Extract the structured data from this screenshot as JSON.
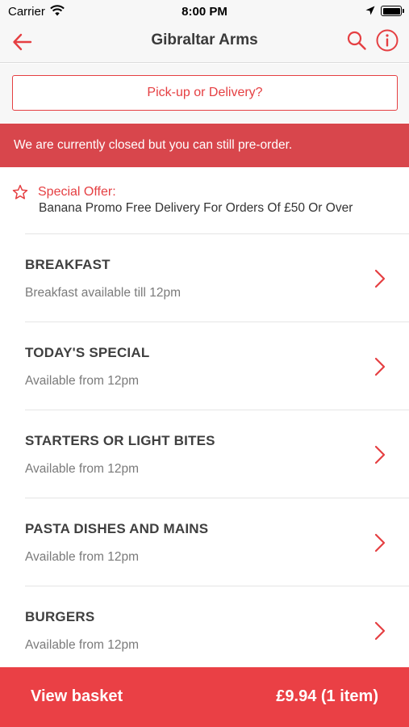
{
  "status_bar": {
    "carrier": "Carrier",
    "time": "8:00 PM"
  },
  "nav": {
    "title": "Gibraltar Arms"
  },
  "pickup": {
    "label": "Pick-up or Delivery?"
  },
  "banner": {
    "text": "We are currently closed but you can still pre-order."
  },
  "offer": {
    "title": "Special Offer:",
    "description": "Banana Promo Free Delivery For Orders Of £50 Or Over"
  },
  "menu": {
    "items": [
      {
        "name": "BREAKFAST",
        "availability": "Breakfast available till 12pm"
      },
      {
        "name": "TODAY'S SPECIAL",
        "availability": "Available from 12pm"
      },
      {
        "name": "STARTERS OR LIGHT BITES",
        "availability": "Available from 12pm"
      },
      {
        "name": "PASTA DISHES AND MAINS",
        "availability": "Available from 12pm"
      },
      {
        "name": "BURGERS",
        "availability": "Available from 12pm"
      }
    ]
  },
  "basket": {
    "label": "View basket",
    "total": "£9.94 (1 item)"
  },
  "colors": {
    "accent": "#e53f42",
    "banner": "#d8464c",
    "basket_bar": "#ea4045"
  },
  "icons": [
    "wifi-icon",
    "location-icon",
    "battery-icon",
    "back-arrow-icon",
    "search-icon",
    "info-icon",
    "star-icon",
    "chevron-right-icon"
  ]
}
